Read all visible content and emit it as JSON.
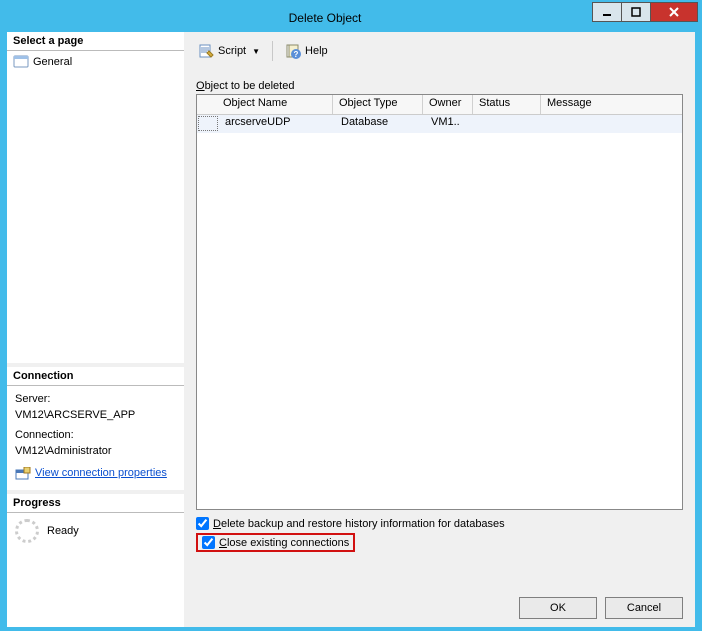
{
  "window": {
    "title": "Delete Object"
  },
  "left": {
    "selectPageHeader": "Select a page",
    "generalPage": "General",
    "connectionHeader": "Connection",
    "serverLabel": "Server:",
    "serverValue": "VM12\\ARCSERVE_APP",
    "connectionLabel": "Connection:",
    "connectionValue": "VM12\\Administrator",
    "viewConnProps": "View connection properties",
    "progressHeader": "Progress",
    "progressStatus": "Ready"
  },
  "toolbar": {
    "script": "Script",
    "help": "Help"
  },
  "main": {
    "listLabel": "Object to be deleted",
    "columns": {
      "name": "Object Name",
      "type": "Object Type",
      "owner": "Owner",
      "status": "Status",
      "message": "Message"
    },
    "rows": [
      {
        "name": "arcserveUDP",
        "type": "Database",
        "owner": "VM1..",
        "status": "",
        "message": ""
      }
    ],
    "opt1": "Delete backup and restore history information for databases",
    "opt2": "Close existing connections"
  },
  "buttons": {
    "ok": "OK",
    "cancel": "Cancel"
  }
}
